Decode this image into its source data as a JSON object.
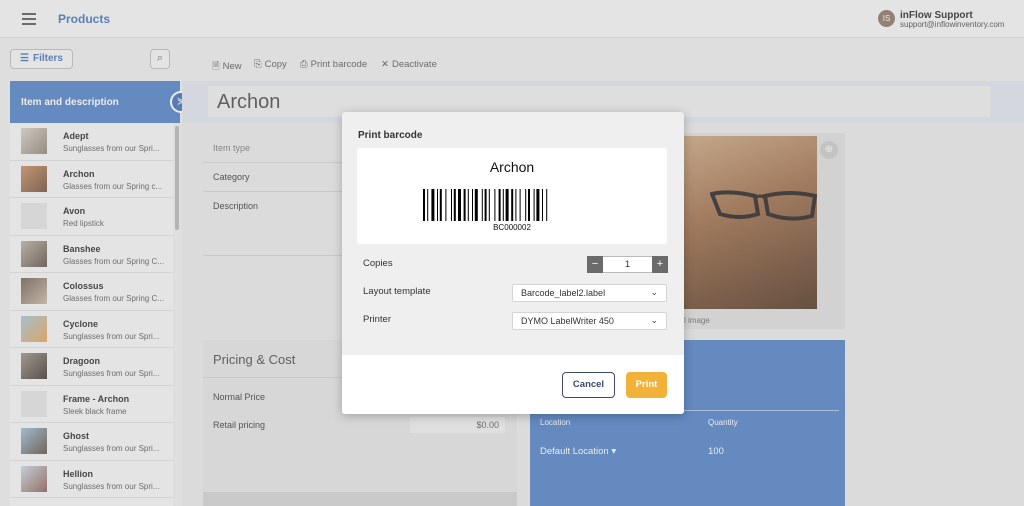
{
  "header": {
    "title": "Products",
    "user": {
      "initials": "IS",
      "name": "inFlow Support",
      "email": "support@inflowinventory.com"
    }
  },
  "sidebar": {
    "filters_label": "Filters",
    "list_header": "Item and description",
    "items": [
      {
        "name": "Adept",
        "desc": "Sunglasses from our Spri..."
      },
      {
        "name": "Archon",
        "desc": "Glasses from our Spring c..."
      },
      {
        "name": "Avon",
        "desc": "Red lipstick"
      },
      {
        "name": "Banshee",
        "desc": "Glasses from our Spring C..."
      },
      {
        "name": "Colossus",
        "desc": "Glasses from our Spring C..."
      },
      {
        "name": "Cyclone",
        "desc": "Sunglasses from our Spri..."
      },
      {
        "name": "Dragoon",
        "desc": "Sunglasses from our Spri..."
      },
      {
        "name": "Frame - Archon",
        "desc": "Sleek black frame"
      },
      {
        "name": "Ghost",
        "desc": "Sunglasses from our Spri..."
      },
      {
        "name": "Hellion",
        "desc": "Sunglasses from our Spri..."
      }
    ]
  },
  "toolbar": {
    "new": "New",
    "copy": "Copy",
    "print_barcode": "Print barcode",
    "deactivate": "Deactivate"
  },
  "product": {
    "title": "Archon",
    "fields": {
      "item_type": "Item type",
      "category": "Category",
      "description": "Description"
    },
    "image_caption": "l image"
  },
  "pricing": {
    "title": "Pricing & Cost",
    "normal_price": "Normal Price",
    "retail_pricing": "Retail pricing",
    "retail_value": "$0.00"
  },
  "location": {
    "col_location": "Location",
    "col_quantity": "Quantity",
    "row_location": "Default Location",
    "row_quantity": "100"
  },
  "modal": {
    "title": "Print barcode",
    "preview_name": "Archon",
    "barcode_text": "BC000002",
    "copies_label": "Copies",
    "copies_value": "1",
    "layout_label": "Layout template",
    "layout_value": "Barcode_label2.label",
    "printer_label": "Printer",
    "printer_value": "DYMO LabelWriter 450",
    "cancel": "Cancel",
    "print": "Print"
  },
  "colors": {
    "brand_blue": "#4a7cc4",
    "print_button": "#f2b23a"
  }
}
